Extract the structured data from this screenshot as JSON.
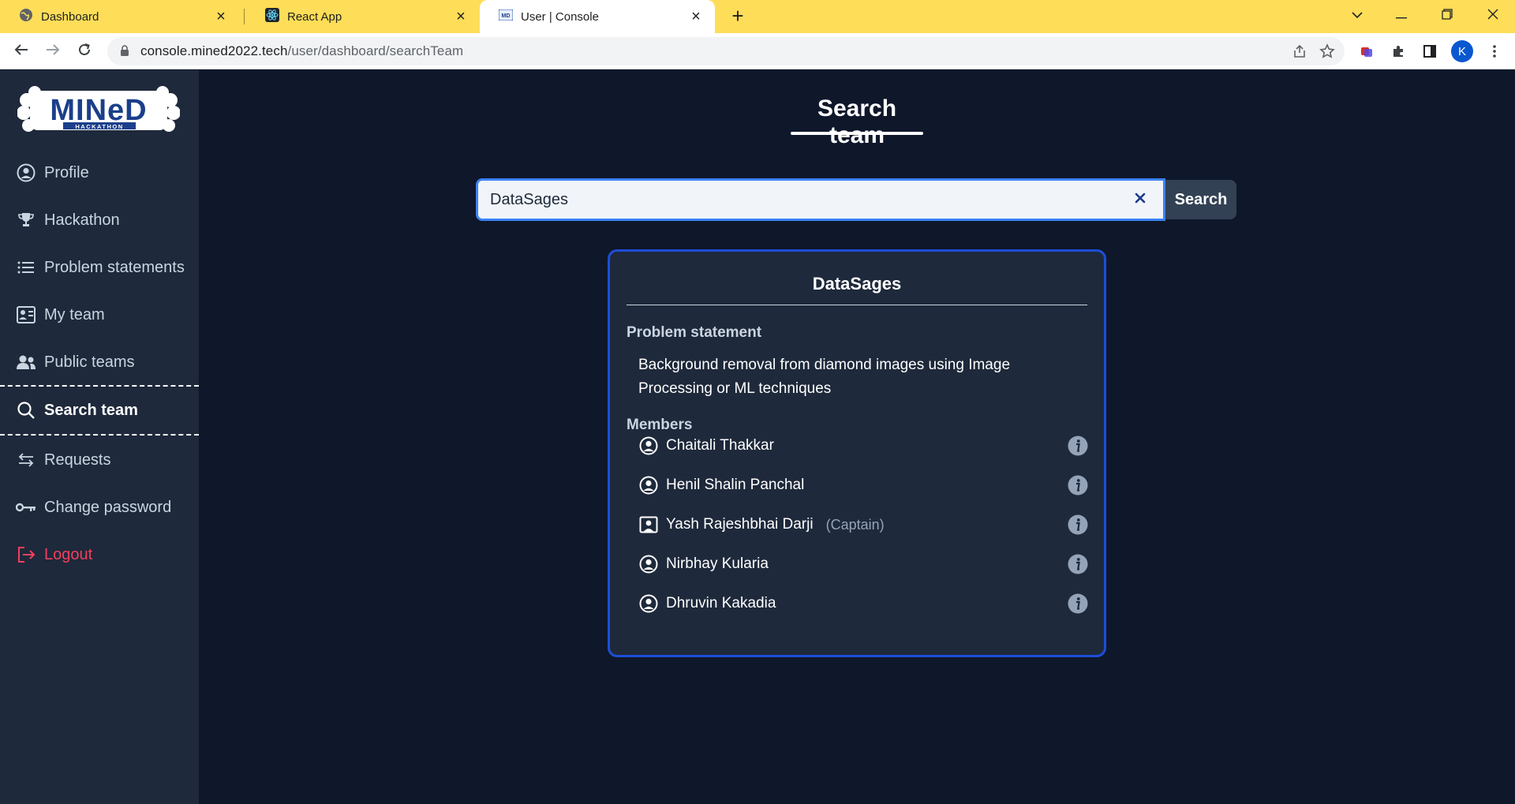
{
  "browser": {
    "tabs": [
      {
        "title": "Dashboard",
        "icon": "globe-icon",
        "active": false
      },
      {
        "title": "React App",
        "icon": "react-icon",
        "active": false
      },
      {
        "title": "User | Console",
        "icon": "mined-favicon",
        "active": true
      }
    ],
    "address": {
      "host": "console.mined2022.tech",
      "path": "/user/dashboard/searchTeam"
    },
    "profile_initial": "K"
  },
  "sidebar": {
    "logo_alt": "MINeD Hackathon",
    "items": [
      {
        "label": "Profile",
        "icon": "user-circle-icon",
        "active": false
      },
      {
        "label": "Hackathon",
        "icon": "trophy-icon",
        "active": false
      },
      {
        "label": "Problem statements",
        "icon": "list-icon",
        "active": false
      },
      {
        "label": "My team",
        "icon": "team-card-icon",
        "active": false
      },
      {
        "label": "Public teams",
        "icon": "people-icon",
        "active": false
      },
      {
        "label": "Search team",
        "icon": "search-icon",
        "active": true
      },
      {
        "label": "Requests",
        "icon": "arrows-swap-icon",
        "active": false
      },
      {
        "label": "Change password",
        "icon": "key-icon",
        "active": false
      },
      {
        "label": "Logout",
        "icon": "logout-icon",
        "active": false
      }
    ]
  },
  "main": {
    "title": "Search team",
    "search": {
      "value": "DataSages",
      "button_label": "Search"
    },
    "result": {
      "team_name": "DataSages",
      "problem_label": "Problem statement",
      "problem_text": "Background removal from diamond images using Image Processing or ML techniques",
      "members_label": "Members",
      "members": [
        {
          "name": "Chaitali Thakkar",
          "role": ""
        },
        {
          "name": "Henil Shalin Panchal",
          "role": ""
        },
        {
          "name": "Yash Rajeshbhai Darji",
          "role": "(Captain)"
        },
        {
          "name": "Nirbhay Kularia",
          "role": ""
        },
        {
          "name": "Dhruvin Kakadia",
          "role": ""
        }
      ]
    }
  },
  "colors": {
    "tabstrip": "#fedd58",
    "sidebar_bg": "#1e293b",
    "main_bg": "#0f172a",
    "accent": "#3b82f6",
    "logout": "#f43f5e"
  }
}
